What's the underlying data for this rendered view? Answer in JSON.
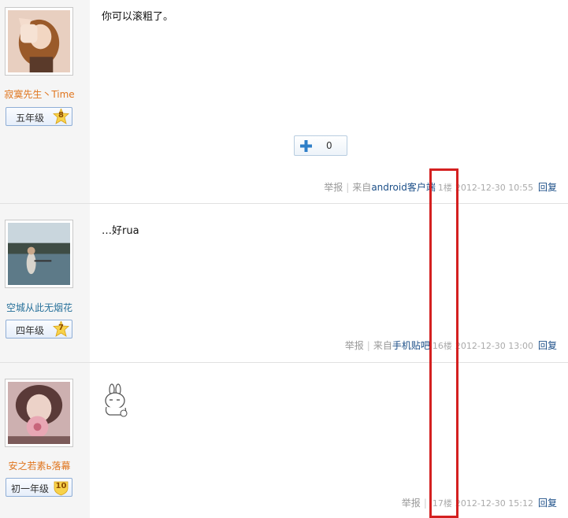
{
  "posts": [
    {
      "user": {
        "name": "寂寞先生丶Time",
        "level": "五年级",
        "level_num": "8"
      },
      "content": "你可以滚粗了。",
      "plus": {
        "count": "0"
      },
      "meta": {
        "report": "举报",
        "source_prefix": "来自",
        "source": "android客户端",
        "floor": "1楼",
        "datetime": "2012-12-30  10:55",
        "reply": "回复"
      }
    },
    {
      "user": {
        "name": "空城从此无烟花",
        "level": "四年级",
        "level_num": "7"
      },
      "content": "…好rua",
      "meta": {
        "report": "举报",
        "source_prefix": "来自",
        "source": "手机贴吧",
        "floor": "16楼",
        "datetime": "2012-12-30  13:00",
        "reply": "回复"
      }
    },
    {
      "user": {
        "name": "安之若素ь落幕",
        "level": "初一年级",
        "level_num": "10"
      },
      "meta": {
        "report": "举报",
        "floor": "17楼",
        "datetime": "2012-12-30  15:12",
        "reply": "回复"
      }
    }
  ],
  "colors": {
    "highlight": "#d42020",
    "link": "#1c4f88",
    "name_orange": "#e0761f",
    "name_blue": "#26709a"
  }
}
